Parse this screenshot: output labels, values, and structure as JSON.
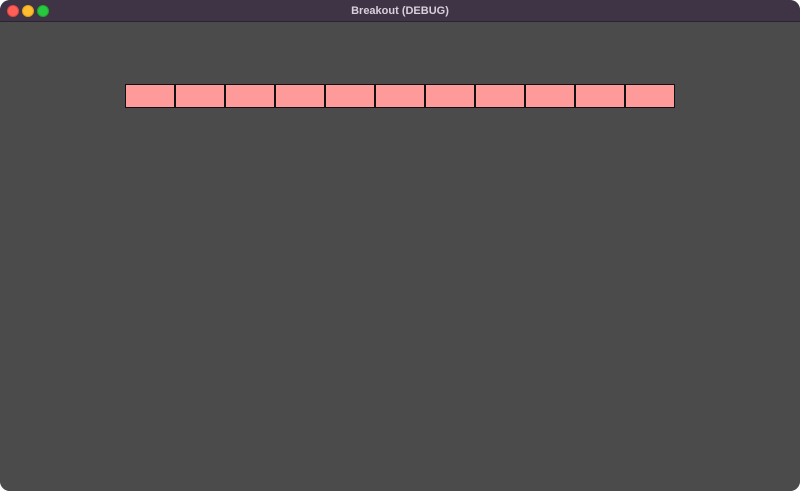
{
  "window": {
    "title": "Breakout (DEBUG)",
    "background_color": "#4b4b4b",
    "titlebar_color": "#3f3445"
  },
  "controls": [
    {
      "name": "close",
      "color": "#ff5f57"
    },
    {
      "name": "minimize",
      "color": "#febc2e"
    },
    {
      "name": "zoom",
      "color": "#28c840"
    }
  ],
  "bricks": {
    "rows": 1,
    "columns": 11,
    "color": "#ff9a9a",
    "border_color": "#111111"
  }
}
